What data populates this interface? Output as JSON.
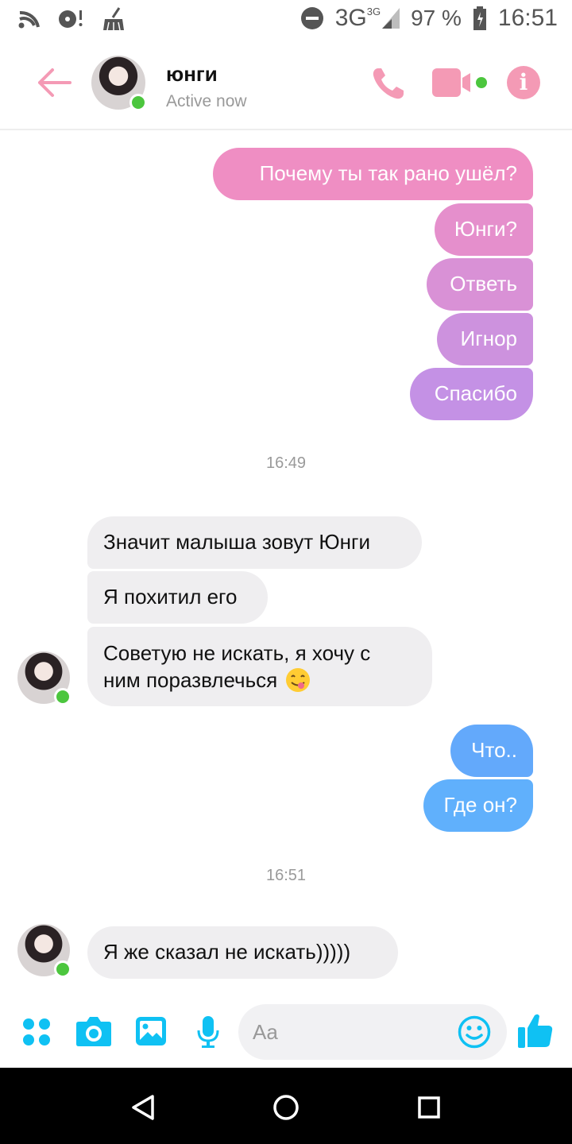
{
  "status_bar": {
    "network": "3G",
    "network_small": "3G",
    "battery": "97 %",
    "time": "16:51"
  },
  "header": {
    "name": "юнги",
    "status": "Active now"
  },
  "messages": {
    "out1": "Почему ты так рано ушёл?",
    "out2": "Юнги?",
    "out3": "Ответь",
    "out4": "Игнор",
    "out5": "Спасибо",
    "time1": "16:49",
    "in1": "Значит малыша зовут Юнги",
    "in2": "Я похитил его",
    "in3_line1": "Советую не искать, я хочу с",
    "in3_line2": "ним поразвлечься",
    "out6": "Что..",
    "out7": "Где он?",
    "time2": "16:51",
    "in4": "Я же сказал не искать)))))"
  },
  "composer": {
    "placeholder": "Aa"
  },
  "colors": {
    "accent_pink": "#f49ab5",
    "bubble_pink": "#ec8fc8",
    "bubble_purple": "#c491e5",
    "bubble_blue": "#62aefc",
    "online": "#4cc63e",
    "tool_blue": "#0fc1f3"
  },
  "icons": [
    "wifi-icon",
    "music-icon",
    "cleaner-icon",
    "dnd-icon",
    "signal-icon",
    "battery-icon",
    "back-arrow-icon",
    "phone-icon",
    "video-icon",
    "info-icon",
    "apps-icon",
    "camera-icon",
    "gallery-icon",
    "mic-icon",
    "emoji-icon",
    "thumbs-up-icon",
    "nav-back-icon",
    "nav-home-icon",
    "nav-recent-icon"
  ]
}
